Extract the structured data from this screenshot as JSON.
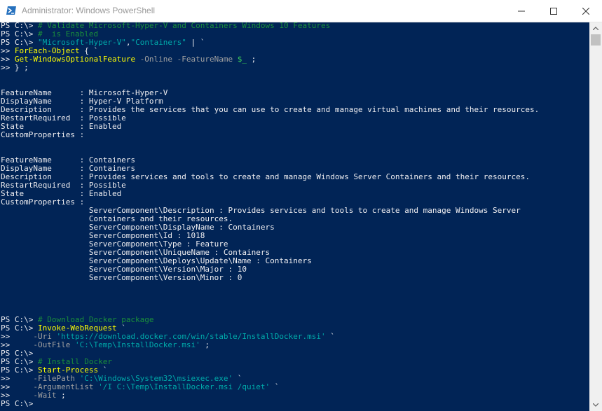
{
  "window": {
    "title": "Administrator: Windows PowerShell",
    "icon": "powershell-icon",
    "buttons": [
      "minimize-icon",
      "maximize-icon",
      "close-icon"
    ]
  },
  "colors": {
    "background": "#012456",
    "foreground": "#eeedf0",
    "command": "#ffff00",
    "string": "#00aaaa",
    "comment": "#1a8f3b",
    "parameter": "#a0a0a0",
    "variable": "#3dd25a"
  },
  "console": {
    "lines": [
      [
        {
          "t": "txt",
          "v": "PS C:\\> "
        },
        {
          "t": "cmt",
          "v": "# Validate Microsoft-Hyper-V and Containers Windows 10 Features"
        }
      ],
      [
        {
          "t": "txt",
          "v": "PS C:\\> "
        },
        {
          "t": "cmt",
          "v": "#  is Enabled"
        }
      ],
      [
        {
          "t": "txt",
          "v": "PS C:\\> "
        },
        {
          "t": "str",
          "v": "\"Microsoft-Hyper-V\""
        },
        {
          "t": "txt",
          "v": ","
        },
        {
          "t": "str",
          "v": "\"Containers\""
        },
        {
          "t": "txt",
          "v": " | `"
        }
      ],
      [
        {
          "t": "txt",
          "v": ">> "
        },
        {
          "t": "cmd",
          "v": "ForEach-Object"
        },
        {
          "t": "txt",
          "v": " { `"
        }
      ],
      [
        {
          "t": "txt",
          "v": ">> "
        },
        {
          "t": "cmd",
          "v": "Get-WindowsOptionalFeature"
        },
        {
          "t": "txt",
          "v": " "
        },
        {
          "t": "par",
          "v": "-Online -FeatureName"
        },
        {
          "t": "txt",
          "v": " "
        },
        {
          "t": "var",
          "v": "$_"
        },
        {
          "t": "txt",
          "v": " ;"
        }
      ],
      [
        {
          "t": "txt",
          "v": ">> } ;"
        }
      ],
      [],
      [],
      [
        {
          "t": "txt",
          "v": "FeatureName      : Microsoft-Hyper-V"
        }
      ],
      [
        {
          "t": "txt",
          "v": "DisplayName      : Hyper-V Platform"
        }
      ],
      [
        {
          "t": "txt",
          "v": "Description      : Provides the services that you can use to create and manage virtual machines and their resources."
        }
      ],
      [
        {
          "t": "txt",
          "v": "RestartRequired  : Possible"
        }
      ],
      [
        {
          "t": "txt",
          "v": "State            : Enabled"
        }
      ],
      [
        {
          "t": "txt",
          "v": "CustomProperties :"
        }
      ],
      [],
      [],
      [
        {
          "t": "txt",
          "v": "FeatureName      : Containers"
        }
      ],
      [
        {
          "t": "txt",
          "v": "DisplayName      : Containers"
        }
      ],
      [
        {
          "t": "txt",
          "v": "Description      : Provides services and tools to create and manage Windows Server Containers and their resources."
        }
      ],
      [
        {
          "t": "txt",
          "v": "RestartRequired  : Possible"
        }
      ],
      [
        {
          "t": "txt",
          "v": "State            : Enabled"
        }
      ],
      [
        {
          "t": "txt",
          "v": "CustomProperties :"
        }
      ],
      [
        {
          "t": "txt",
          "v": "                   ServerComponent\\Description : Provides services and tools to create and manage Windows Server"
        }
      ],
      [
        {
          "t": "txt",
          "v": "                   Containers and their resources."
        }
      ],
      [
        {
          "t": "txt",
          "v": "                   ServerComponent\\DisplayName : Containers"
        }
      ],
      [
        {
          "t": "txt",
          "v": "                   ServerComponent\\Id : 1018"
        }
      ],
      [
        {
          "t": "txt",
          "v": "                   ServerComponent\\Type : Feature"
        }
      ],
      [
        {
          "t": "txt",
          "v": "                   ServerComponent\\UniqueName : Containers"
        }
      ],
      [
        {
          "t": "txt",
          "v": "                   ServerComponent\\Deploys\\Update\\Name : Containers"
        }
      ],
      [
        {
          "t": "txt",
          "v": "                   ServerComponent\\Version\\Major : 10"
        }
      ],
      [
        {
          "t": "txt",
          "v": "                   ServerComponent\\Version\\Minor : 0"
        }
      ],
      [],
      [],
      [],
      [],
      [
        {
          "t": "txt",
          "v": "PS C:\\> "
        },
        {
          "t": "cmt",
          "v": "# Download Docker package"
        }
      ],
      [
        {
          "t": "txt",
          "v": "PS C:\\> "
        },
        {
          "t": "cmd",
          "v": "Invoke-WebRequest"
        },
        {
          "t": "txt",
          "v": " `"
        }
      ],
      [
        {
          "t": "txt",
          "v": ">>     "
        },
        {
          "t": "par",
          "v": "-Uri"
        },
        {
          "t": "txt",
          "v": " "
        },
        {
          "t": "str",
          "v": "'https://download.docker.com/win/stable/InstallDocker.msi'"
        },
        {
          "t": "txt",
          "v": " `"
        }
      ],
      [
        {
          "t": "txt",
          "v": ">>     "
        },
        {
          "t": "par",
          "v": "-OutFile"
        },
        {
          "t": "txt",
          "v": " "
        },
        {
          "t": "str",
          "v": "'C:\\Temp\\InstallDocker.msi'"
        },
        {
          "t": "txt",
          "v": " ;"
        }
      ],
      [
        {
          "t": "txt",
          "v": "PS C:\\>"
        }
      ],
      [
        {
          "t": "txt",
          "v": "PS C:\\> "
        },
        {
          "t": "cmt",
          "v": "# Install Docker"
        }
      ],
      [
        {
          "t": "txt",
          "v": "PS C:\\> "
        },
        {
          "t": "cmd",
          "v": "Start-Process"
        },
        {
          "t": "txt",
          "v": " `"
        }
      ],
      [
        {
          "t": "txt",
          "v": ">>     "
        },
        {
          "t": "par",
          "v": "-FilePath"
        },
        {
          "t": "txt",
          "v": " "
        },
        {
          "t": "str",
          "v": "'C:\\Windows\\System32\\msiexec.exe'"
        },
        {
          "t": "txt",
          "v": " `"
        }
      ],
      [
        {
          "t": "txt",
          "v": ">>     "
        },
        {
          "t": "par",
          "v": "-ArgumentList"
        },
        {
          "t": "txt",
          "v": " "
        },
        {
          "t": "str",
          "v": "'/I C:\\Temp\\InstallDocker.msi /quiet'"
        },
        {
          "t": "txt",
          "v": " `"
        }
      ],
      [
        {
          "t": "txt",
          "v": ">>     "
        },
        {
          "t": "par",
          "v": "-Wait"
        },
        {
          "t": "txt",
          "v": " ;"
        }
      ],
      [
        {
          "t": "txt",
          "v": "PS C:\\>"
        }
      ]
    ]
  }
}
